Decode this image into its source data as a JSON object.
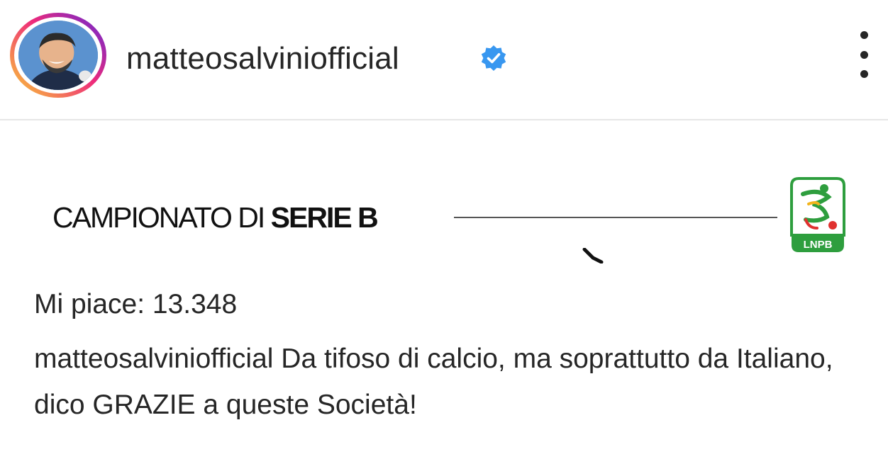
{
  "post": {
    "username": "matteosalviniofficial",
    "verified": true,
    "likes_text": "Mi piace: 13.348",
    "caption_user": "matteosalviniofficial",
    "caption_text": "Da tifoso di calcio, ma soprattutto da Italiano, dico GRAZIE a queste Società!"
  },
  "image": {
    "title_regular": "CAMPIONATO DI ",
    "title_bold": "SERIE B",
    "logo_text": "LNPB"
  },
  "icons": {
    "verified": "verified-badge-icon",
    "more": "more-options-icon",
    "avatar": "profile-avatar"
  },
  "colors": {
    "verified_blue": "#3897f0",
    "lnpb_green": "#2e9e3e",
    "ring_gradient": [
      "#f9ce34",
      "#ee2a7b",
      "#6228d7"
    ]
  }
}
